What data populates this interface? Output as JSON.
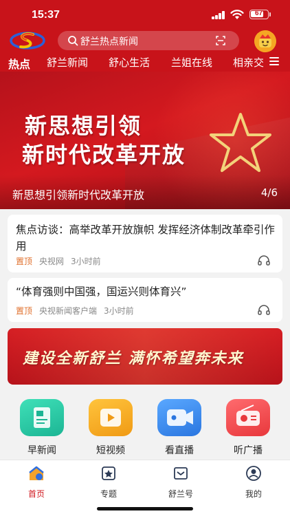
{
  "status_bar": {
    "time": "15:37",
    "battery": "67"
  },
  "header": {
    "search_placeholder": "舒兰热点新闻",
    "tabs": [
      {
        "label": "热点",
        "active": true
      },
      {
        "label": "舒兰新闻",
        "active": false
      },
      {
        "label": "舒心生活",
        "active": false
      },
      {
        "label": "兰姐在线",
        "active": false
      },
      {
        "label": "相亲交",
        "active": false
      }
    ]
  },
  "banner": {
    "line1": "新思想引领",
    "line2": "新时代改革开放",
    "caption": "新思想引领新时代改革开放",
    "page_indicator": "4/6"
  },
  "news": [
    {
      "title": "焦点访谈：高举改革开放旗帜 发挥经济体制改革牵引作用",
      "pin": "置顶",
      "source": "央视网",
      "time": "3小时前"
    },
    {
      "title": "“体育强则中国强，国运兴则体育兴”",
      "pin": "置顶",
      "source": "央视新闻客户端",
      "time": "3小时前"
    }
  ],
  "promo": {
    "text": "建设全新舒兰 满怀希望奔未来"
  },
  "quick_actions": [
    {
      "label": "早新闻",
      "icon": "news-icon",
      "color": "#2ec9a6"
    },
    {
      "label": "短视频",
      "icon": "video-icon",
      "color": "#f5a623"
    },
    {
      "label": "看直播",
      "icon": "live-icon",
      "color": "#3b8eea"
    },
    {
      "label": "听广播",
      "icon": "radio-icon",
      "color": "#f0474b"
    }
  ],
  "bottom_nav": [
    {
      "label": "首页",
      "icon": "home-icon",
      "active": true
    },
    {
      "label": "专题",
      "icon": "topic-icon",
      "active": false
    },
    {
      "label": "舒兰号",
      "icon": "account-icon",
      "active": false
    },
    {
      "label": "我的",
      "icon": "profile-icon",
      "active": false
    }
  ],
  "colors": {
    "brand_red": "#c8131a",
    "active_red": "#d0181f",
    "pin_orange": "#e0702c"
  }
}
